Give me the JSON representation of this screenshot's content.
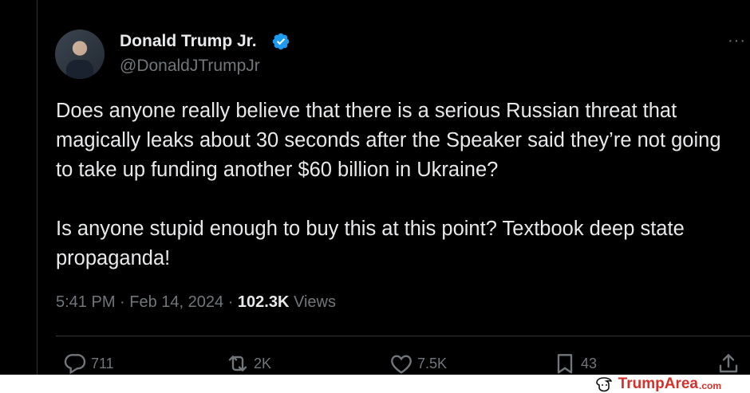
{
  "tweet": {
    "author": {
      "display_name": "Donald Trump Jr.",
      "handle": "@DonaldJTrumpJr"
    },
    "more_label": "···",
    "text": {
      "paragraph_1": "Does anyone really believe that there is a serious Russian threat that magically leaks about 30 seconds after the Speaker said they’re not going to take up funding another $60 billion in Ukraine?",
      "paragraph_2": "Is anyone stupid enough to buy this at this point? Textbook deep state propaganda!"
    },
    "meta": {
      "time": "5:41 PM",
      "separator": " · ",
      "date": "Feb 14, 2024",
      "views_count": "102.3K",
      "views_label": " Views"
    },
    "actions": {
      "replies": "711",
      "reposts": "2K",
      "likes": "7.5K",
      "bookmarks": "43"
    }
  },
  "footer": {
    "brand_name": "TrumpArea",
    "brand_tld": ".com"
  },
  "colors": {
    "background": "#000000",
    "text": "#e7e9ea",
    "muted": "#71767b",
    "verified": "#1d9bf0",
    "brand": "#d6302a"
  }
}
